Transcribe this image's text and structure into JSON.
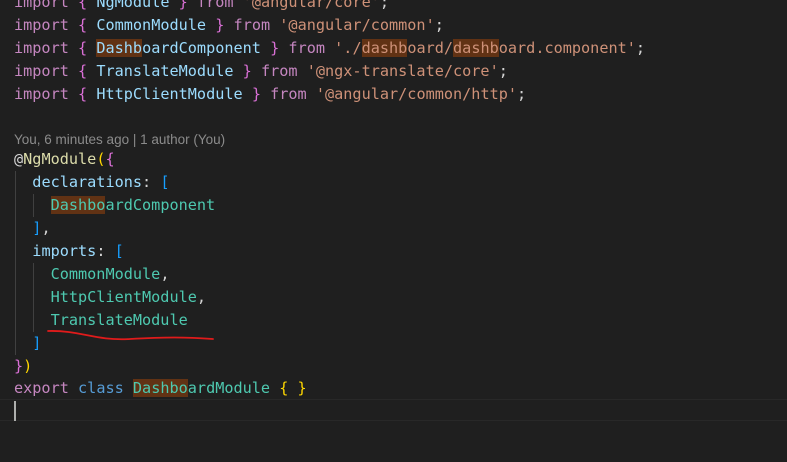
{
  "editor": {
    "lines": [
      {
        "tokens": [
          {
            "t": "import",
            "c": "kw"
          },
          {
            "t": " "
          },
          {
            "t": "{",
            "c": "br2"
          },
          {
            "t": " "
          },
          {
            "t": "NgModule",
            "c": "var"
          },
          {
            "t": " "
          },
          {
            "t": "}",
            "c": "br2"
          },
          {
            "t": " "
          },
          {
            "t": "from",
            "c": "kw"
          },
          {
            "t": " "
          },
          {
            "t": "'@angular/core'",
            "c": "str"
          },
          {
            "t": ";",
            "c": "pun"
          }
        ]
      },
      {
        "tokens": [
          {
            "t": "import",
            "c": "kw"
          },
          {
            "t": " "
          },
          {
            "t": "{",
            "c": "br2"
          },
          {
            "t": " "
          },
          {
            "t": "CommonModule",
            "c": "var"
          },
          {
            "t": " "
          },
          {
            "t": "}",
            "c": "br2"
          },
          {
            "t": " "
          },
          {
            "t": "from",
            "c": "kw"
          },
          {
            "t": " "
          },
          {
            "t": "'@angular/common'",
            "c": "str"
          },
          {
            "t": ";",
            "c": "pun"
          }
        ]
      },
      {
        "tokens": [
          {
            "t": "import",
            "c": "kw"
          },
          {
            "t": " "
          },
          {
            "t": "{",
            "c": "br2"
          },
          {
            "t": " "
          },
          {
            "t": "Dashb",
            "c": "var hl"
          },
          {
            "t": "oa",
            "c": "var"
          },
          {
            "t": "rdComponent",
            "c": "var"
          },
          {
            "t": " "
          },
          {
            "t": "}",
            "c": "br2"
          },
          {
            "t": " "
          },
          {
            "t": "from",
            "c": "kw"
          },
          {
            "t": " "
          },
          {
            "t": "'./",
            "c": "str"
          },
          {
            "t": "dashb",
            "c": "str hl"
          },
          {
            "t": "oard/",
            "c": "str"
          },
          {
            "t": "dashb",
            "c": "str hl"
          },
          {
            "t": "oard.component'",
            "c": "str"
          },
          {
            "t": ";",
            "c": "pun"
          }
        ]
      },
      {
        "tokens": [
          {
            "t": "import",
            "c": "kw"
          },
          {
            "t": " "
          },
          {
            "t": "{",
            "c": "br2"
          },
          {
            "t": " "
          },
          {
            "t": "TranslateModule",
            "c": "var"
          },
          {
            "t": " "
          },
          {
            "t": "}",
            "c": "br2"
          },
          {
            "t": " "
          },
          {
            "t": "from",
            "c": "kw"
          },
          {
            "t": " "
          },
          {
            "t": "'@ngx-translate/core'",
            "c": "str"
          },
          {
            "t": ";",
            "c": "pun"
          }
        ]
      },
      {
        "tokens": [
          {
            "t": "import",
            "c": "kw"
          },
          {
            "t": " "
          },
          {
            "t": "{",
            "c": "br2"
          },
          {
            "t": " "
          },
          {
            "t": "HttpClientModule",
            "c": "var"
          },
          {
            "t": " "
          },
          {
            "t": "}",
            "c": "br2"
          },
          {
            "t": " "
          },
          {
            "t": "from",
            "c": "kw"
          },
          {
            "t": " "
          },
          {
            "t": "'@angular/common/http'",
            "c": "str"
          },
          {
            "t": ";",
            "c": "pun"
          }
        ]
      },
      {
        "tokens": []
      },
      {
        "tokens": [
          {
            "t": "@",
            "c": "pun"
          },
          {
            "t": "NgModule",
            "c": "fn"
          },
          {
            "t": "(",
            "c": "br1"
          },
          {
            "t": "{",
            "c": "br2"
          }
        ]
      },
      {
        "tokens": [
          {
            "t": "  "
          },
          {
            "t": "declarations",
            "c": "var"
          },
          {
            "t": ": ",
            "c": "pun"
          },
          {
            "t": "[",
            "c": "br3"
          }
        ]
      },
      {
        "tokens": [
          {
            "t": "    "
          },
          {
            "t": "Dashbo",
            "c": "cls hl"
          },
          {
            "t": "ardComponent",
            "c": "cls"
          }
        ]
      },
      {
        "tokens": [
          {
            "t": "  "
          },
          {
            "t": "]",
            "c": "br3"
          },
          {
            "t": ",",
            "c": "pun"
          }
        ]
      },
      {
        "tokens": [
          {
            "t": "  "
          },
          {
            "t": "imports",
            "c": "var"
          },
          {
            "t": ": ",
            "c": "pun"
          },
          {
            "t": "[",
            "c": "br3"
          }
        ]
      },
      {
        "tokens": [
          {
            "t": "    "
          },
          {
            "t": "CommonModule",
            "c": "cls"
          },
          {
            "t": ",",
            "c": "pun"
          }
        ]
      },
      {
        "tokens": [
          {
            "t": "    "
          },
          {
            "t": "HttpClientModule",
            "c": "cls"
          },
          {
            "t": ",",
            "c": "pun"
          }
        ]
      },
      {
        "tokens": [
          {
            "t": "    "
          },
          {
            "t": "TranslateModule",
            "c": "cls"
          }
        ]
      },
      {
        "tokens": [
          {
            "t": "  "
          },
          {
            "t": "]",
            "c": "br3"
          }
        ]
      },
      {
        "tokens": [
          {
            "t": "}",
            "c": "br2"
          },
          {
            "t": ")",
            "c": "br1"
          }
        ]
      },
      {
        "tokens": [
          {
            "t": "export",
            "c": "kw"
          },
          {
            "t": " "
          },
          {
            "t": "class",
            "c": "kw2"
          },
          {
            "t": " "
          },
          {
            "t": "Dashbo",
            "c": "cls hl"
          },
          {
            "t": "ardModule",
            "c": "cls"
          },
          {
            "t": " "
          },
          {
            "t": "{",
            "c": "br1"
          },
          {
            "t": " "
          },
          {
            "t": "}",
            "c": "br1"
          }
        ]
      },
      {
        "tokens": []
      }
    ],
    "blame": "You, 6 minutes ago | 1 author (You)",
    "annotation_color": "#e01b1b"
  }
}
